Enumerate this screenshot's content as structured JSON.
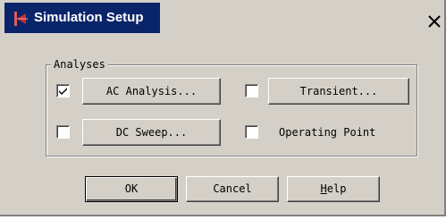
{
  "window": {
    "title": "Simulation Setup",
    "close_glyph": "X"
  },
  "analyses": {
    "group_label": "Analyses",
    "ac_analysis": {
      "label": "AC Analysis...",
      "checked": true
    },
    "transient": {
      "label": "Transient...",
      "checked": false
    },
    "dc_sweep": {
      "label": "DC Sweep...",
      "checked": false
    },
    "operating_point": {
      "label": "Operating Point",
      "checked": false
    }
  },
  "buttons": {
    "ok": "OK",
    "cancel": "Cancel",
    "help_mnemonic": "H",
    "help_rest": "elp"
  },
  "icons": {
    "app": "pspice-app-icon",
    "close": "close-icon",
    "check": "checkmark-icon"
  },
  "colors": {
    "titlebar_active": "#0a246a",
    "face": "#d4d0c8"
  }
}
